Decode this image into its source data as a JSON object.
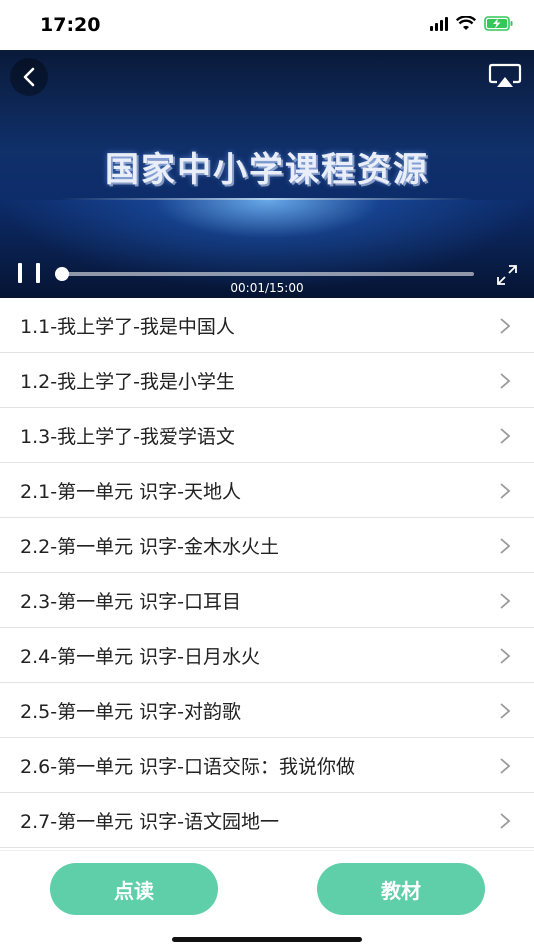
{
  "status_bar": {
    "time": "17:20"
  },
  "video": {
    "title": "国家中小学课程资源",
    "time_display": "00:01/15:00",
    "progress": 0.001
  },
  "lessons": [
    {
      "label": "1.1-我上学了-我是中国人"
    },
    {
      "label": "1.2-我上学了-我是小学生"
    },
    {
      "label": "1.3-我上学了-我爱学语文"
    },
    {
      "label": "2.1-第一单元 识字-天地人"
    },
    {
      "label": "2.2-第一单元 识字-金木水火土"
    },
    {
      "label": "2.3-第一单元 识字-口耳目"
    },
    {
      "label": "2.4-第一单元 识字-日月水火"
    },
    {
      "label": "2.5-第一单元 识字-对韵歌"
    },
    {
      "label": "2.6-第一单元 识字-口语交际：我说你做"
    },
    {
      "label": "2.7-第一单元 识字-语文园地一"
    }
  ],
  "bottom_bar": {
    "read_button": "点读",
    "textbook_button": "教材"
  },
  "colors": {
    "accent": "#5fcfa9"
  }
}
